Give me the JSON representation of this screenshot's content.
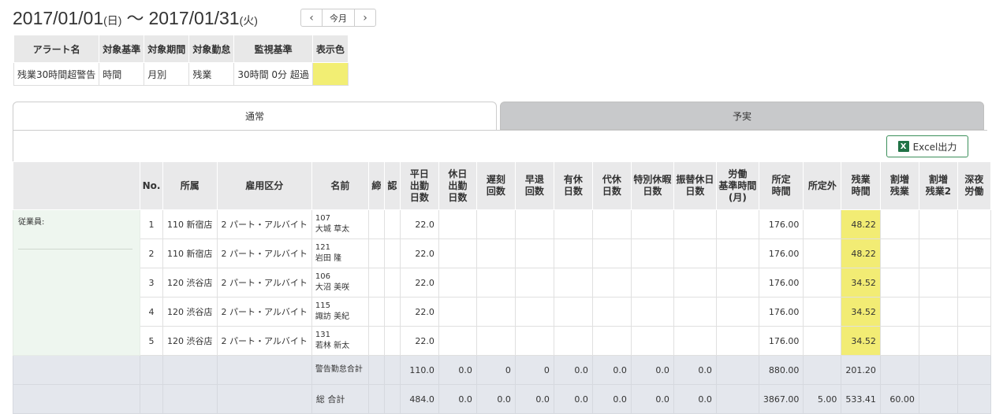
{
  "header": {
    "start_date": "2017/01/01",
    "start_dow": "(日)",
    "tilde": "〜",
    "end_date": "2017/01/31",
    "end_dow": "(火)",
    "pager": {
      "prev": "‹",
      "current": "今月",
      "next": "›"
    }
  },
  "alert_table": {
    "headers": [
      "アラート名",
      "対象基準",
      "対象期間",
      "対象勤怠",
      "監視基準",
      "表示色"
    ],
    "row": [
      "残業30時間超警告",
      "時間",
      "月別",
      "残業",
      "30時間 0分 超過",
      ""
    ],
    "color": "#f2ee73"
  },
  "tabs": {
    "normal": "通常",
    "budget_actual": "予実"
  },
  "excel_button": {
    "label": "Excel出力",
    "icon_letter": "X"
  },
  "grid": {
    "headers": {
      "no": "No.",
      "dept": "所属",
      "emp_type": "雇用区分",
      "name": "名前",
      "close": "締",
      "approve": "認",
      "weekday_days": [
        "平日",
        "出勤",
        "日数"
      ],
      "holiday_days": [
        "休日",
        "出勤",
        "日数"
      ],
      "late": [
        "遅刻",
        "回数"
      ],
      "early": [
        "早退",
        "回数"
      ],
      "paid_leave": [
        "有休",
        "日数"
      ],
      "comp_leave": [
        "代休",
        "日数"
      ],
      "special_leave": [
        "特別休暇",
        "日数"
      ],
      "transfer_holiday": [
        "振替休日",
        "日数"
      ],
      "labor_std": [
        "労働",
        "基準時間",
        "(月)"
      ],
      "scheduled": [
        "所定",
        "時間"
      ],
      "non_scheduled": "所定外",
      "overtime": [
        "残業",
        "時間"
      ],
      "extra_overtime": [
        "割増",
        "残業"
      ],
      "extra_overtime2": [
        "割増",
        "残業2"
      ],
      "late_night": [
        "深夜",
        "労働"
      ]
    },
    "side_label": "従業員:",
    "rows": [
      {
        "no": "1",
        "dept": "110 新宿店",
        "type": "2 パート・アルバイト",
        "code": "107",
        "name": "大城 草太",
        "weekday": "22.0",
        "scheduled": "176.00",
        "overtime": "48.22"
      },
      {
        "no": "2",
        "dept": "110 新宿店",
        "type": "2 パート・アルバイト",
        "code": "121",
        "name": "岩田 隆",
        "weekday": "22.0",
        "scheduled": "176.00",
        "overtime": "48.22"
      },
      {
        "no": "3",
        "dept": "120 渋谷店",
        "type": "2 パート・アルバイト",
        "code": "106",
        "name": "大沼 美咲",
        "weekday": "22.0",
        "scheduled": "176.00",
        "overtime": "34.52"
      },
      {
        "no": "4",
        "dept": "120 渋谷店",
        "type": "2 パート・アルバイト",
        "code": "115",
        "name": "諏訪 美紀",
        "weekday": "22.0",
        "scheduled": "176.00",
        "overtime": "34.52"
      },
      {
        "no": "5",
        "dept": "120 渋谷店",
        "type": "2 パート・アルバイト",
        "code": "131",
        "name": "若林 新太",
        "weekday": "22.0",
        "scheduled": "176.00",
        "overtime": "34.52"
      }
    ],
    "alert_total": {
      "label": "警告勤怠合計",
      "weekday": "110.0",
      "holiday": "0.0",
      "late": "0",
      "early": "0",
      "paid": "0.0",
      "comp": "0.0",
      "special": "0.0",
      "transfer": "0.0",
      "scheduled": "880.00",
      "overtime": "201.20"
    },
    "grand_total": {
      "label": "総 合計",
      "weekday": "484.0",
      "holiday": "0.0",
      "late": "0.0",
      "early": "0.0",
      "paid": "0.0",
      "comp": "0.0",
      "special": "0.0",
      "transfer": "0.0",
      "scheduled": "3867.00",
      "non_scheduled": "5.00",
      "overtime": "533.41",
      "extra_overtime": "60.00"
    }
  }
}
